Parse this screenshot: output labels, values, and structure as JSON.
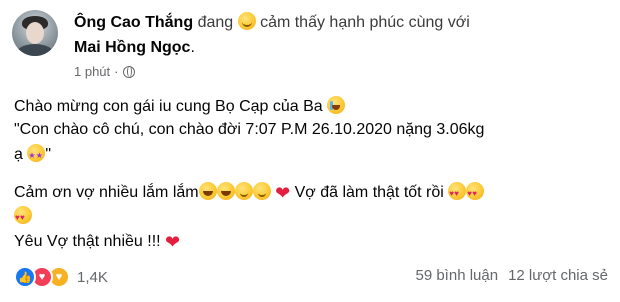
{
  "post": {
    "author": "Ông Cao Thắng",
    "status_prefix": "đang",
    "status_text": "cảm thấy hạnh phúc cùng với",
    "tagged_person": "Mai Hồng Ngọc",
    "tagged_suffix": ".",
    "time": "1 phút",
    "time_separator": "·",
    "privacy_icon": "globe-icon",
    "lines": {
      "l1": "Chào mừng con gái iu cung Bọ Cạp của Ba",
      "l2": "\"Con chào cô chú, con chào đời 7:07 P.M 26.10.2020 nặng 3.06kg",
      "l3": "ạ",
      "l3_end": "\"",
      "l4a": "Cảm ơn vợ nhiều lắm lắm",
      "l4b": "Vợ đã làm thật tốt rồi",
      "l6": "Yêu Vợ thật nhiều !!!"
    },
    "heart_glyph": "❤",
    "reactions": {
      "icons": [
        "like-icon",
        "love-icon",
        "care-icon"
      ],
      "count": "1,4K"
    },
    "comments": "59 bình luận",
    "shares": "12 lượt chia sẻ"
  }
}
